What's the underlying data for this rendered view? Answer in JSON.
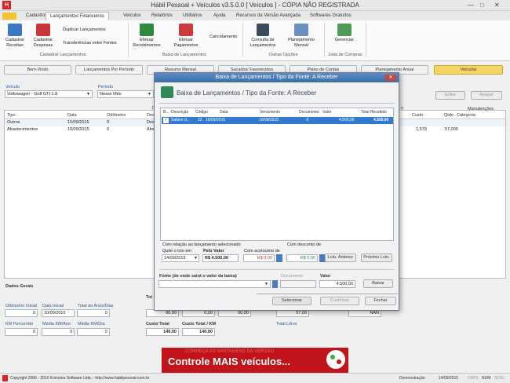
{
  "window": {
    "title": "Hábil Pessoal + Veículos v3.5.0.0 [ Veículos ] - CÓPIA NÃO REGISTRADA",
    "minimize": "—",
    "maximize": "□",
    "close": "✕"
  },
  "tabs": [
    "Cadastros",
    "Lançamentos Financeiros",
    "Veículos",
    "Relatórios",
    "Utilitários",
    "Ajuda",
    "Recursos da Versão Avançada",
    "Softwares Gratuitos"
  ],
  "ribbon": {
    "cadastrar_receitas": "Cadastrar Receitas",
    "cadastrar_despesas": "Cadastrar Despesas",
    "duplicar": "Duplicar Lançamentos",
    "transferencias": "Transferências entre Fontes",
    "group_cadastro": "Cadastrar Lançamentos",
    "efetuar_recebimentos": "Efetuar Recebimentos",
    "efetuar_pagamentos": "Efetuar Pagamentos",
    "cancelamento": "Cancelamento",
    "group_baixa": "Baixa de Lançamentos",
    "consulta": "Consulta de Lançamentos",
    "planejamento": "Planejamento Mensal",
    "group_outras": "Outras Opções",
    "gerenciar": "Gerenciar",
    "group_lista": "Lista de Compras"
  },
  "nav": [
    "Bem-Vindo",
    "Lançamentos Por Período",
    "Resumo Mensal",
    "Sacados/ Favorecidos",
    "Plano de Contas",
    "Planejamento Anual",
    "Veículos"
  ],
  "filters": {
    "veiculo_label": "Veículo",
    "veiculo_value": "Volkswagen - Golf GTI 1.8",
    "periodo_label": "Período",
    "periodo_value": "Nesse Mês",
    "editar": "Editar",
    "apagar": "Apagar"
  },
  "grid": {
    "headers": [
      "Tipo",
      "Data",
      "Odômetro",
      "Desc"
    ],
    "right_headers": [
      "Custo",
      "Qtde",
      "Categoria"
    ],
    "manutencoes": "Manutenções",
    "letter_d": "D",
    "letter_s": "s",
    "rows": [
      {
        "tipo": "Outros",
        "data": "10/09/2015",
        "odometro": "0",
        "desc": "Desc",
        "custo": "",
        "qtde": ""
      },
      {
        "tipo": "Abastecimentos",
        "data": "10/09/2015",
        "odometro": "0",
        "desc": "Aba",
        "custo": "1,579",
        "qtde": "57,000"
      }
    ]
  },
  "bottom": {
    "dados_gerais": "Dados Gerais",
    "tot_label": "Tot",
    "odometro_inicial_label": "Odômetro Inicial",
    "odometro_inicial": "0",
    "data_inicial_label": "Data Inicial",
    "data_inicial": "10/09/2015",
    "total_anos_label": "Total de Anos/Dias",
    "total_anos": "0",
    "f90": "90,00",
    "f0": "0,00",
    "f50": "50,00",
    "f57": "57,00",
    "fnan": "NAN",
    "km_percorrido_label": "KM Percorrido",
    "km_percorrido": "0",
    "media_km_ano_label": "Média KM/Ano",
    "media_km_ano": "0",
    "media_km_dia_label": "Média KM/Dia",
    "media_km_dia": "0",
    "custo_total_label": "Custo Total",
    "custo_total": "140,00",
    "custo_total_km_label": "Custo Total / KM",
    "custo_total_km": "140,00",
    "total_litros_label": "Total Litros"
  },
  "dialog": {
    "title": "Baixa de Lançamentos / Tipo da Fonte: A Receber",
    "close": "✕",
    "header": "Baixa de Lançamentos / Tipo da Fonte: A Receber",
    "columns": [
      "B...",
      "Descrição",
      "Código",
      "Data",
      "Vencimento",
      "Documento",
      "Valor",
      "Total Recebido"
    ],
    "row": {
      "check": "✓",
      "descricao": "Salário d...",
      "codigo": "22",
      "data": "10/09/2015",
      "vencimento": "10/09/2015",
      "documento": "-2",
      "valor": "4.500,00",
      "total": "4.500,00"
    },
    "com_relacao": "Com relação ao lançamento selecionado",
    "quite_label": "Quite o lcto em",
    "quite_value": "14/09/2015",
    "pelo_valor_label": "Pelo Valor",
    "pelo_valor": "R$ 4.500,00",
    "acrescimo_label": "Com acréscimo de",
    "acrescimo": "R$ 0,00",
    "desconto_label": "Com desconto de",
    "desconto": "R$ 0,00",
    "lcto_anterior": "Lcto. Anterior",
    "proximo": "Próximo Lcto.",
    "fonte_label": "Fonte (de onde sairá o valor da baixa)",
    "documento_label": "Documento",
    "valor_label": "Valor",
    "valor": "4.500,00",
    "baixar": "Baixar",
    "selecionar": "Selecionar",
    "confirmar": "Confirmar",
    "fechar": "Fechar"
  },
  "ad": {
    "text": "Controle MAIS veículos...",
    "ghost": "CONHEÇA AS VANTAGENS DA VERSÃO"
  },
  "status": {
    "copyright": "Copyright 2006 - 2010 Koinonia Software Ltda. - http://www.habilpessoal.com.br",
    "demo": "Demonstração",
    "date": "14/09/2015",
    "caps": "CAPS",
    "num": "NUM",
    "scrl": "SCRL"
  },
  "colors": {
    "accent_blue": "#3379cf",
    "nav_active": "#f7d561",
    "ad_red": "#c1131a"
  }
}
